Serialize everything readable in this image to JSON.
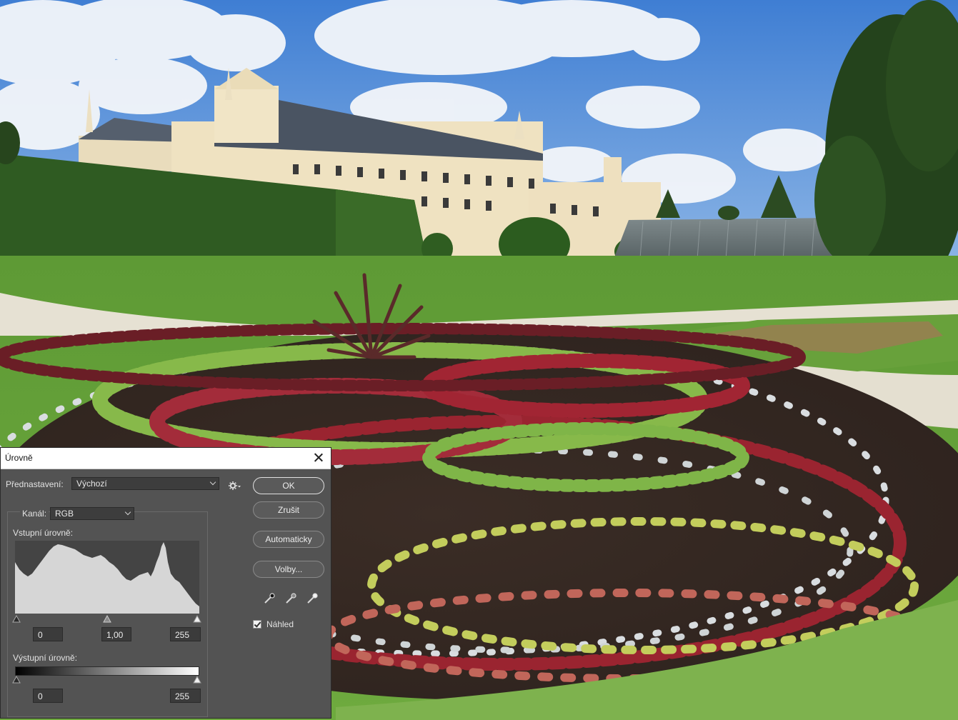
{
  "dialog": {
    "title": "Úrovně",
    "preset_label": "Přednastavení:",
    "preset_value": "Výchozí",
    "channel_label": "Kanál:",
    "channel_value": "RGB",
    "input_levels_label": "Vstupní úrovně:",
    "input_black": "0",
    "input_gamma": "1,00",
    "input_white": "255",
    "output_levels_label": "Výstupní úrovně:",
    "output_black": "0",
    "output_white": "255",
    "buttons": {
      "ok": "OK",
      "cancel": "Zrušit",
      "auto": "Automaticky",
      "options": "Volby..."
    },
    "preview_label": "Náhled",
    "preview_checked": true
  },
  "colors": {
    "dialog_bg": "#535353",
    "histogram_fill": "#d6d6d6",
    "sky": "#5d92d6",
    "castle": "#efe1bd",
    "roof": "#4b5563",
    "hedge": "#2f5c22",
    "lawn": "#5f9a36",
    "soil": "#3a2b24"
  }
}
